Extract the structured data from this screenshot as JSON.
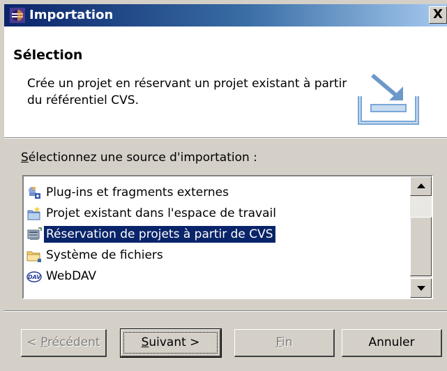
{
  "window": {
    "title": "Importation",
    "close_label": "X"
  },
  "header": {
    "title": "Sélection",
    "description": "Crée un projet en réservant un projet existant à partir du référentiel CVS."
  },
  "prompt": {
    "prefix_underlined": "S",
    "rest": "électionnez une source d'importation :"
  },
  "list": {
    "items": [
      {
        "label": "Plug-ins et fragments externes",
        "icon": "plugin-icon"
      },
      {
        "label": "Projet existant dans l'espace de travail",
        "icon": "project-icon"
      },
      {
        "label": "Réservation de projets à partir de CVS",
        "icon": "cvs-icon",
        "selected": true
      },
      {
        "label": "Système de fichiers",
        "icon": "folder-icon"
      },
      {
        "label": "WebDAV",
        "icon": "webdav-icon"
      }
    ],
    "selected_index": 2
  },
  "buttons": {
    "back": {
      "before": "< ",
      "mnemonic": "P",
      "after": "récédent",
      "enabled": false
    },
    "next": {
      "mnemonic": "S",
      "after": "uivant >",
      "enabled": true
    },
    "finish": {
      "mnemonic": "F",
      "after": "in",
      "enabled": false
    },
    "cancel": {
      "label": "Annuler",
      "enabled": true
    }
  },
  "colors": {
    "title_bar": "#0a246a",
    "selection": "#0a246a",
    "face": "#d4d0c8"
  }
}
